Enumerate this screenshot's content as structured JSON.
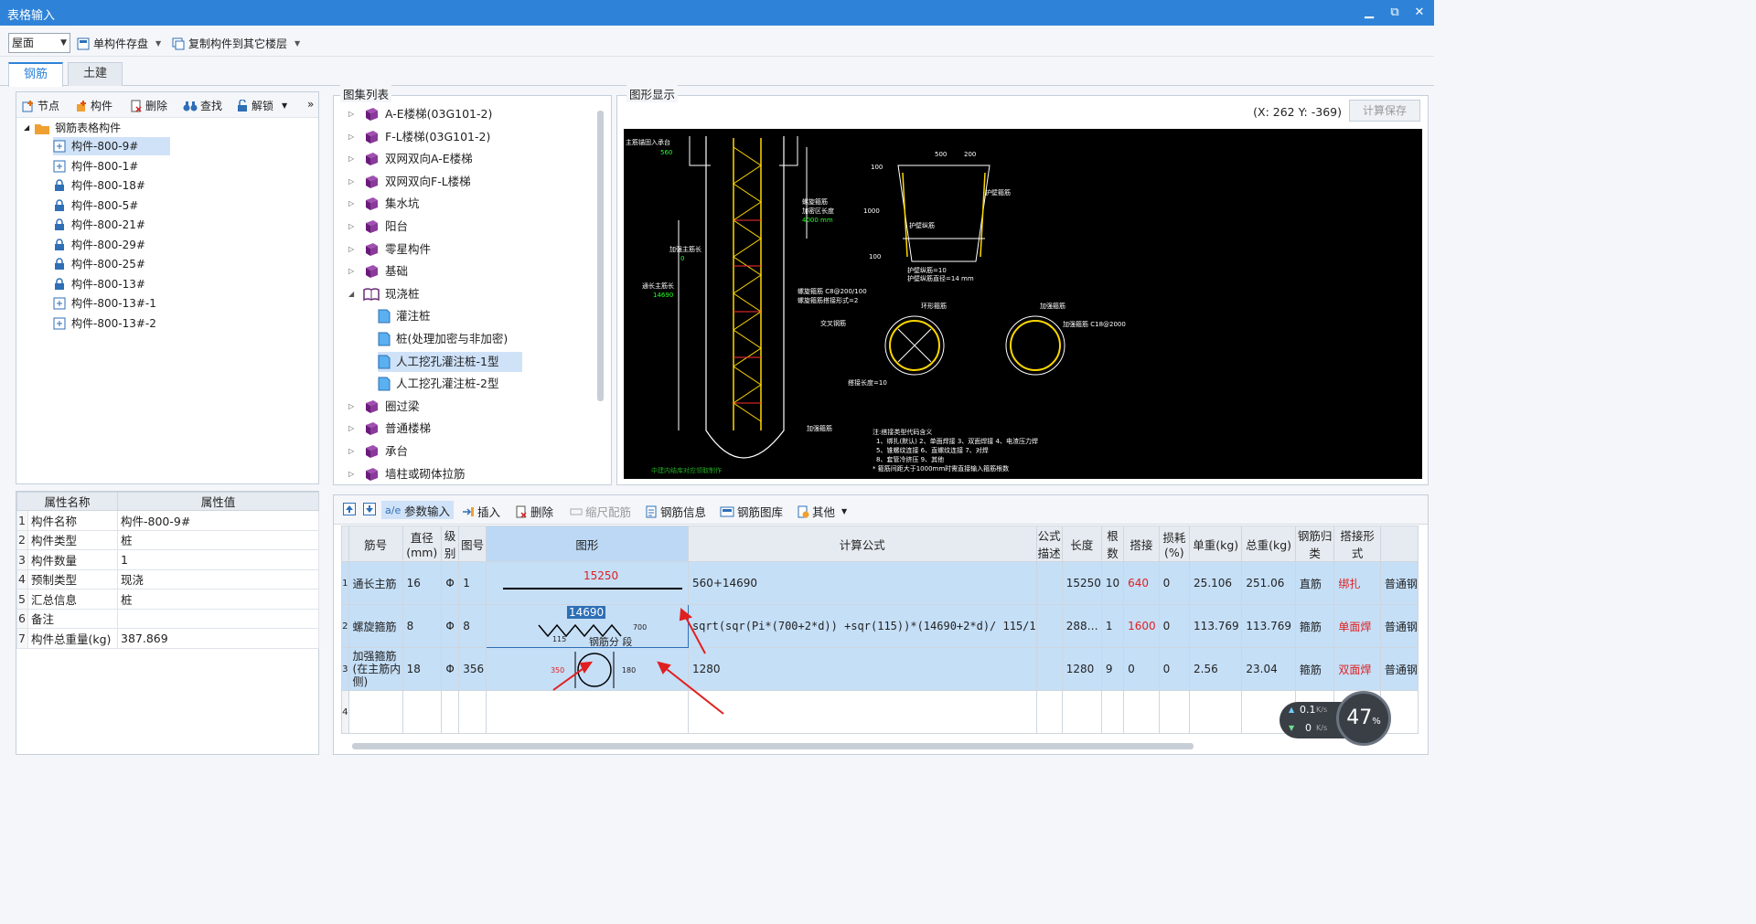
{
  "window": {
    "title": "表格输入",
    "minimize": "▁",
    "restore": "⧉",
    "close": "✕"
  },
  "toolbar": {
    "floor": "屋面",
    "save_component": "单构件存盘",
    "copy_to_floor": "复制构件到其它楼层"
  },
  "tabs": [
    {
      "label": "钢筋"
    },
    {
      "label": "土建"
    }
  ],
  "tree_toolbar": {
    "node": "节点",
    "component": "构件",
    "delete": "删除",
    "find": "查找",
    "unlock": "解锁",
    "more": "»"
  },
  "tree": {
    "root": "钢筋表格构件",
    "items": [
      "构件-800-9#",
      "构件-800-1#",
      "构件-800-18#",
      "构件-800-5#",
      "构件-800-21#",
      "构件-800-29#",
      "构件-800-25#",
      "构件-800-13#",
      "构件-800-13#-1",
      "构件-800-13#-2"
    ]
  },
  "properties": {
    "header_name": "属性名称",
    "header_value": "属性值",
    "rows": [
      {
        "idx": "1",
        "name": "构件名称",
        "value": "构件-800-9#"
      },
      {
        "idx": "2",
        "name": "构件类型",
        "value": "桩"
      },
      {
        "idx": "3",
        "name": "构件数量",
        "value": "1"
      },
      {
        "idx": "4",
        "name": "预制类型",
        "value": "现浇"
      },
      {
        "idx": "5",
        "name": "汇总信息",
        "value": "桩"
      },
      {
        "idx": "6",
        "name": "备注",
        "value": ""
      },
      {
        "idx": "7",
        "name": "构件总重量(kg)",
        "value": "387.869"
      }
    ]
  },
  "atlas": {
    "label": "图集列表",
    "items": [
      "A-E楼梯(03G101-2)",
      "F-L楼梯(03G101-2)",
      "双网双向A-E楼梯",
      "双网双向F-L楼梯",
      "集水坑",
      "阳台",
      "零星构件",
      "基础",
      "现浇桩",
      "灌注桩",
      "桩(处理加密与非加密)",
      "人工挖孔灌注桩-1型",
      "人工挖孔灌注桩-2型",
      "圈过梁",
      "普通楼梯",
      "承台",
      "墙柱或砌体拉筋"
    ]
  },
  "graphic": {
    "label": "图形显示",
    "coord": "(X: 262 Y: -369)",
    "calc_save": "计算保存",
    "drawing": {
      "t1": "主筋锚固入承台",
      "t1v": "560",
      "t2": "螺旋箍筋",
      "t2a": "加密区长度",
      "t2v": "4000 mm",
      "t3": "加强主筋长",
      "t3v": "0",
      "t4": "通长主筋长",
      "t4v": "14690",
      "t5": "螺旋箍筋 C8@200/100",
      "t6": "螺旋箍筋搭接形式=2",
      "t7": "500",
      "t8": "200",
      "t9": "100",
      "t10": "1000",
      "t11": "100",
      "t12": "护壁箍筋",
      "t13": "护壁纵筋",
      "t14": "护壁纵筋=10",
      "t15": "护壁纵筋直径=14 mm",
      "t16": "交叉钢筋",
      "t17": "环形箍筋",
      "t18": "加强箍筋",
      "t19": "加强箍筋 C18@2000",
      "t20": "搭接长度=10",
      "t21": "加强箍筋",
      "t22": "注:搭接类型代码含义",
      "t23": "1、绑扎(默认)  2、单面焊接  3、双面焊接  4、电渣压力焊",
      "t24": "5、锥螺纹连接  6、直螺纹连接  7、对焊",
      "t25": "8、套管冷挤压  9、其他",
      "t26": "* 箍筋间距大于1000mm时需直接输入箍筋根数",
      "watermark": "中建内结库对应领取制作"
    }
  },
  "grid_toolbar": {
    "param_input": "参数输入",
    "insert": "插入",
    "delete": "删除",
    "scale": "缩尺配筋",
    "rebar_info": "钢筋信息",
    "rebar_lib": "钢筋图库",
    "other": "其他"
  },
  "grid": {
    "headers": [
      "筋号",
      "直径(mm)",
      "级别",
      "图号",
      "图形",
      "计算公式",
      "公式描述",
      "长度",
      "根数",
      "搭接",
      "损耗(%)",
      "单重(kg)",
      "总重(kg)",
      "钢筋归类",
      "搭接形式"
    ],
    "rows": [
      {
        "idx": "1",
        "name": "通长主筋",
        "dia": "16",
        "grade": "Φ",
        "fig": "1",
        "shape_len": "15250",
        "formula": "560+14690",
        "desc": "",
        "length": "15250",
        "count": "10",
        "lap": "640",
        "loss": "0",
        "unit_wt": "25.106",
        "total_wt": "251.06",
        "category": "直筋",
        "lap_type": "绑扎",
        "extra": "普通钢"
      },
      {
        "idx": "2",
        "name": "螺旋箍筋",
        "dia": "8",
        "grade": "Φ",
        "fig": "8",
        "shape_len": "14690",
        "shape_a": "115",
        "shape_b": "700",
        "shape_c": "钢筋分 段",
        "formula": "sqrt(sqr(Pi*(700+2*d))\n+sqr(115))*(14690+2*d)/\n115/1",
        "desc": "",
        "length": "288…",
        "count": "1",
        "lap": "1600",
        "loss": "0",
        "unit_wt": "113.769",
        "total_wt": "113.769",
        "category": "箍筋",
        "lap_type": "单面焊",
        "extra": "普通钢"
      },
      {
        "idx": "3",
        "name": "加强箍筋(在主筋内侧)",
        "dia": "18",
        "grade": "Φ",
        "fig": "356",
        "shape_a": "350",
        "shape_b": "180",
        "formula": "1280",
        "desc": "",
        "length": "1280",
        "count": "9",
        "lap": "0",
        "loss": "0",
        "unit_wt": "2.56",
        "total_wt": "23.04",
        "category": "箍筋",
        "lap_type": "双面焊",
        "extra": "普通钢"
      },
      {
        "idx": "4"
      }
    ]
  },
  "speed": {
    "up": "0.1",
    "up_unit": "K/s",
    "down": "0",
    "down_unit": "K/s",
    "percent": "47",
    "pct_sign": "%"
  }
}
